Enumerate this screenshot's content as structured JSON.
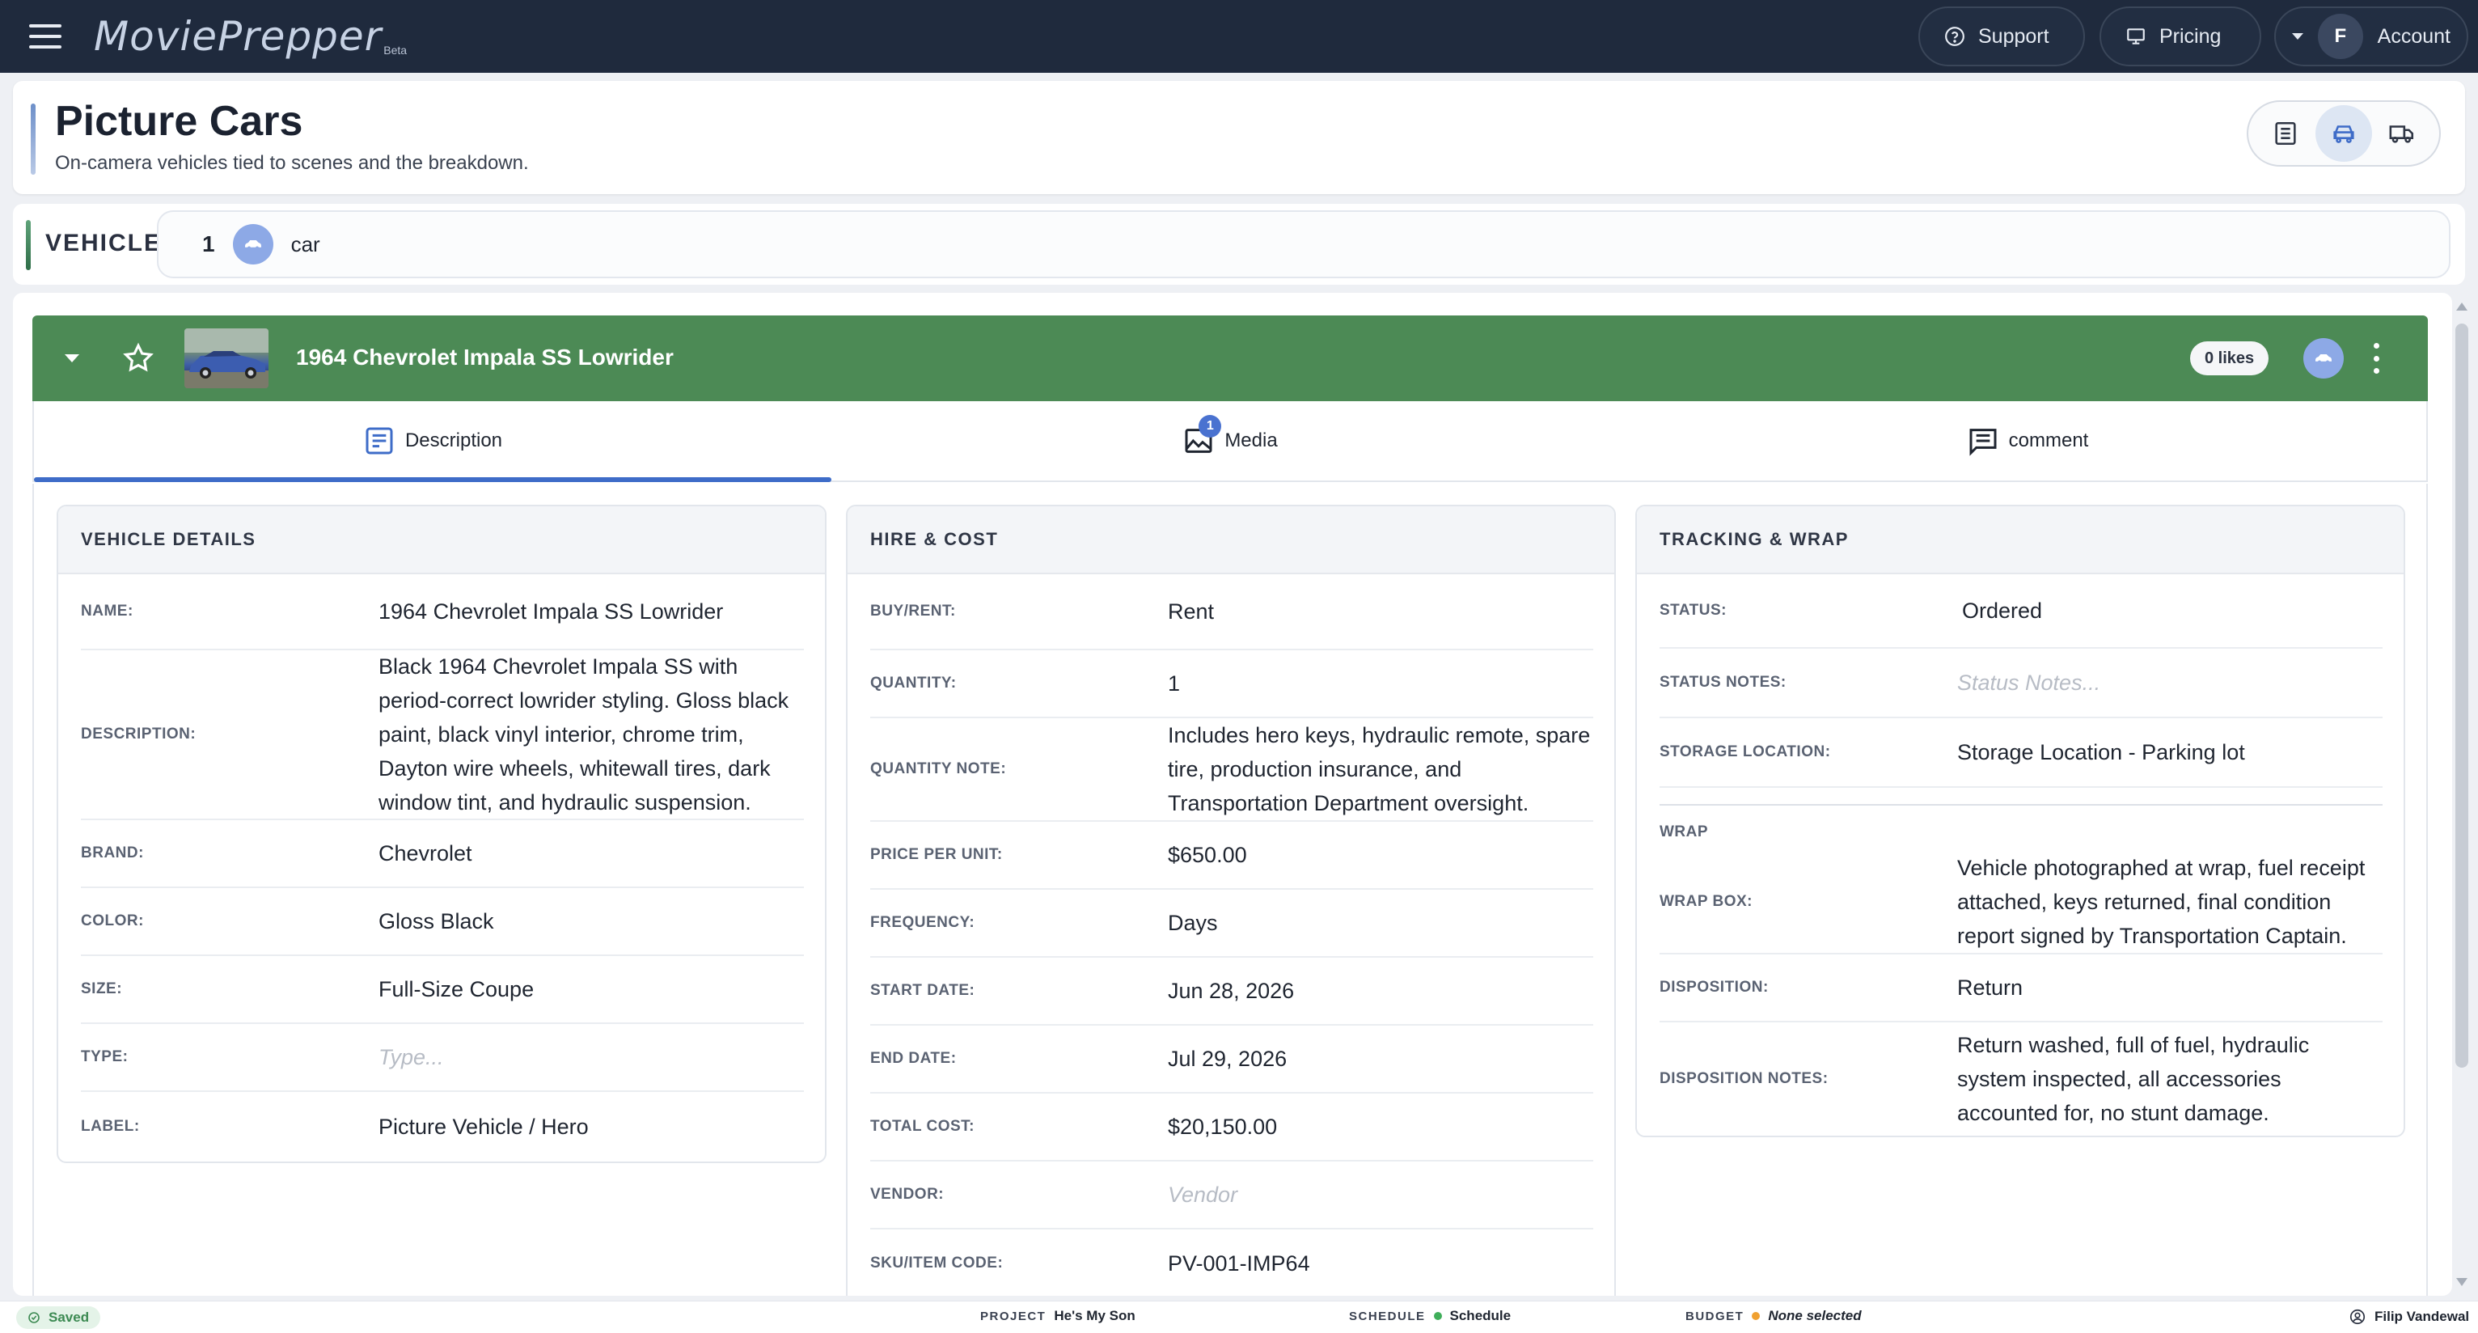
{
  "app": {
    "logo": "MoviePrepper",
    "logo_tag": "Beta",
    "nav": {
      "support": "Support",
      "pricing": "Pricing",
      "account": "Account",
      "account_initial": "F"
    }
  },
  "header": {
    "title": "Picture Cars",
    "subtitle": "On-camera vehicles tied to scenes and the breakdown."
  },
  "vehicle_filter": {
    "label": "VEHICLE",
    "count": "1",
    "chip": "car"
  },
  "vehicle": {
    "name": "1964 Chevrolet Impala SS Lowrider",
    "likes": "0 likes"
  },
  "tabs": [
    {
      "label": "Description",
      "icon": "description-icon"
    },
    {
      "label": "Media",
      "icon": "image-icon",
      "badge": "1"
    },
    {
      "label": "comment",
      "icon": "comment-icon"
    }
  ],
  "cards": {
    "details": {
      "title": "VEHICLE DETAILS",
      "rows": [
        {
          "label": "NAME:",
          "value": "1964 Chevrolet Impala SS Lowrider"
        },
        {
          "label": "DESCRIPTION:",
          "value": "Black 1964 Chevrolet Impala SS with period-correct lowrider styling. Gloss black paint, black vinyl interior, chrome trim, Dayton wire wheels, whitewall tires, dark window tint, and hydraulic suspension."
        },
        {
          "label": "BRAND:",
          "value": "Chevrolet"
        },
        {
          "label": "COLOR:",
          "value": "Gloss Black"
        },
        {
          "label": "SIZE:",
          "value": "Full-Size Coupe"
        },
        {
          "label": "TYPE:",
          "placeholder": "Type..."
        },
        {
          "label": "LABEL:",
          "value": "Picture Vehicle / Hero"
        }
      ]
    },
    "hire": {
      "title": "HIRE & COST",
      "rows": [
        {
          "label": "BUY/RENT:",
          "value": "Rent"
        },
        {
          "label": "QUANTITY:",
          "value": "1"
        },
        {
          "label": "QUANTITY NOTE:",
          "value": "Includes hero keys, hydraulic remote, spare tire, production insurance, and Transportation Department oversight."
        },
        {
          "label": "PRICE PER UNIT:",
          "value": "$650.00"
        },
        {
          "label": "FREQUENCY:",
          "value": "Days"
        },
        {
          "label": "START DATE:",
          "value": "Jun 28, 2026"
        },
        {
          "label": "END DATE:",
          "value": "Jul 29, 2026"
        },
        {
          "label": "TOTAL COST:",
          "value": "$20,150.00"
        },
        {
          "label": "VENDOR:",
          "placeholder": "Vendor"
        },
        {
          "label": "SKU/ITEM CODE:",
          "value": "PV-001-IMP64"
        }
      ]
    },
    "tracking": {
      "title": "TRACKING & WRAP",
      "rows": [
        {
          "label": "STATUS:",
          "value": "Ordered"
        },
        {
          "label": "STATUS NOTES:",
          "placeholder": "Status Notes..."
        },
        {
          "label": "STORAGE LOCATION:",
          "value": "Storage Location - Parking lot"
        }
      ],
      "wrap_label": "WRAP",
      "wrap_rows": [
        {
          "label": "WRAP BOX:",
          "value": "Vehicle photographed at wrap, fuel receipt attached, keys returned, final condition report signed by Transportation Captain."
        },
        {
          "label": "DISPOSITION:",
          "value": "Return"
        },
        {
          "label": "DISPOSITION NOTES:",
          "value": "Return washed, full of fuel, hydraulic system inspected, all accessories accounted for, no stunt damage."
        }
      ]
    }
  },
  "footer": {
    "saved": "Saved",
    "project_key": "PROJECT",
    "project_val": "He's My Son",
    "schedule_key": "SCHEDULE",
    "schedule_val": "Schedule",
    "budget_key": "BUDGET",
    "budget_val": "None selected",
    "user": "Filip Vandewal"
  },
  "colors": {
    "topbar": "#1f2a3d",
    "vehicle_row": "#4c8a55",
    "accent_blue": "#3e6cc8",
    "car_chip": "#8da9e6",
    "schedule_dot": "#3fae5a",
    "budget_dot": "#f0a030"
  }
}
